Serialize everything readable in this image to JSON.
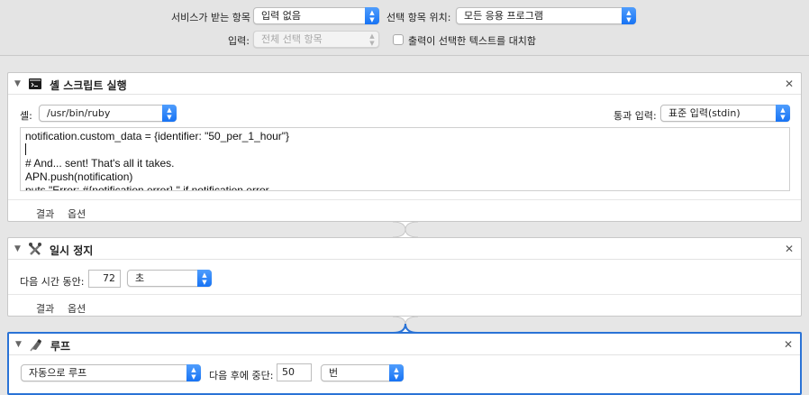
{
  "service_bar": {
    "receives_label": "서비스가 받는 항목",
    "receives_value": "입력 없음",
    "in_label": "선택 항목 위치:",
    "in_value": "모든 응용 프로그램",
    "input_label": "입력:",
    "input_value": "전체 선택 항목",
    "replace_label": "출력이 선택한 텍스트를 대치함"
  },
  "actions": [
    {
      "title": "셸 스크립트 실행",
      "shell_label": "셸:",
      "shell_value": "/usr/bin/ruby",
      "pass_input_label": "통과 입력:",
      "pass_input_value": "표준 입력(stdin)",
      "script_lines": [
        "notification.custom_data = {identifier: \"50_per_1_hour\"}",
        "",
        "# And... sent! That's all it takes.",
        "APN.push(notification)",
        "puts \"Error: #{notification.error}.\" if notification.error"
      ],
      "tab_results": "결과",
      "tab_options": "옵션",
      "icon": "terminal-icon"
    },
    {
      "title": "일시 정지",
      "duration_label": "다음 시간 동안:",
      "duration_value": "72",
      "unit_value": "초",
      "tab_results": "결과",
      "tab_options": "옵션",
      "icon": "pause-tools-icon"
    },
    {
      "title": "루프",
      "mode_value": "자동으로 루프",
      "stop_label": "다음 후에 중단:",
      "stop_value": "50",
      "stop_unit_value": "번",
      "icon": "loop-icon"
    }
  ],
  "colors": {
    "accent": "#1773f4",
    "selected_border": "#2a73d6"
  }
}
